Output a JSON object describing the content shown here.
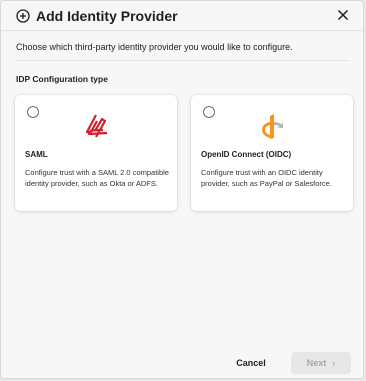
{
  "dialog": {
    "title": "Add Identity Provider",
    "description": "Choose which third-party identity provider you would like to configure.",
    "section_label": "IDP Configuration type"
  },
  "options": [
    {
      "title": "SAML",
      "description": "Configure trust with a SAML 2.0 compatible identity provider, such as Okta or ADFS.",
      "logo_icon": "saml-logo-icon",
      "selected": false
    },
    {
      "title": "OpenID Connect (OIDC)",
      "description": "Configure trust with an OIDC identity provider, such as PayPal or Salesforce.",
      "logo_icon": "openid-logo-icon",
      "selected": false
    }
  ],
  "footer": {
    "cancel_label": "Cancel",
    "next_label": "Next",
    "next_chevron": "›"
  },
  "colors": {
    "saml_red": "#d1222e",
    "openid_orange": "#f7931e",
    "openid_gray": "#b3b3b3",
    "next_disabled_bg": "#e7e7e7"
  }
}
